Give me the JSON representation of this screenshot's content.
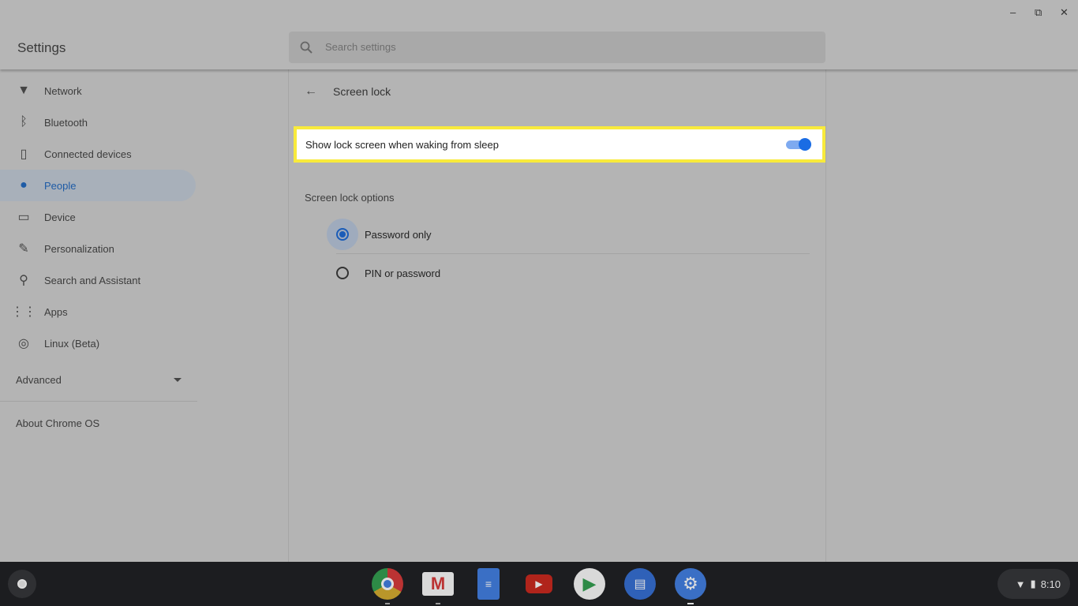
{
  "window": {
    "title": "Settings",
    "controls": {
      "minimize": "–",
      "maximize": "⧉",
      "close": "✕"
    }
  },
  "search": {
    "placeholder": "Search settings"
  },
  "sidebar": {
    "items": [
      {
        "label": "Network",
        "icon": "wifi-icon"
      },
      {
        "label": "Bluetooth",
        "icon": "bluetooth-icon"
      },
      {
        "label": "Connected devices",
        "icon": "phone-icon"
      },
      {
        "label": "People",
        "icon": "person-icon",
        "active": true
      },
      {
        "label": "Device",
        "icon": "laptop-icon"
      },
      {
        "label": "Personalization",
        "icon": "brush-icon"
      },
      {
        "label": "Search and Assistant",
        "icon": "search-icon"
      },
      {
        "label": "Apps",
        "icon": "apps-grid-icon"
      },
      {
        "label": "Linux (Beta)",
        "icon": "penguin-icon"
      }
    ],
    "advanced": "Advanced",
    "about": "About Chrome OS"
  },
  "main": {
    "title": "Screen lock",
    "toggle": {
      "label": "Show lock screen when waking from sleep",
      "on": true
    },
    "options_heading": "Screen lock options",
    "options": [
      {
        "label": "Password only",
        "selected": true
      },
      {
        "label": "PIN or password",
        "selected": false
      }
    ]
  },
  "shelf": {
    "apps": [
      "Chrome",
      "Gmail",
      "Docs",
      "YouTube",
      "Play Store",
      "Messages",
      "Settings"
    ],
    "time": "8:10"
  },
  "colors": {
    "accent": "#1a6ce4",
    "highlight": "#f8ea3c"
  }
}
